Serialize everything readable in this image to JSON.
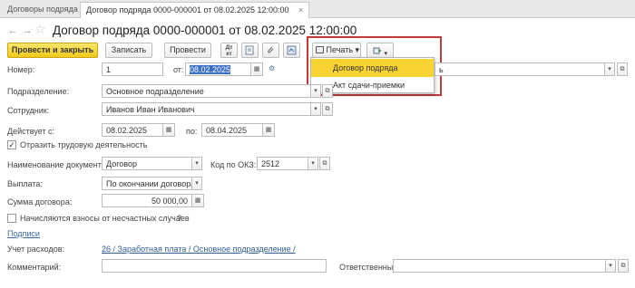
{
  "tabs": [
    {
      "label": "Договоры подряда",
      "active": false
    },
    {
      "label": "Договор подряда 0000-000001 от 08.02.2025 12:00:00",
      "active": true
    }
  ],
  "window": {
    "title": "Договор подряда 0000-000001 от 08.02.2025 12:00:00",
    "close_glyph": "×",
    "star_glyph": "☆",
    "back_glyph": "←",
    "forward_glyph": "→"
  },
  "toolbar": {
    "post_close": "Провести и закрыть",
    "save": "Записать",
    "post": "Провести",
    "dt_kt_top": "Дт",
    "dt_kt_bottom": "кт",
    "print": "Печать",
    "print_arrow": "▾"
  },
  "print_menu": {
    "items": [
      {
        "label": "Договор подряда",
        "selected": true
      },
      {
        "label": "Акт сдачи-приемки",
        "selected": false
      }
    ]
  },
  "form": {
    "number_label": "Номер:",
    "number_value": "1",
    "date_from_label": "от:",
    "date_from_value": "08.02.2025",
    "organization_suffix": "ь",
    "department_label": "Подразделение:",
    "department_value": "Основное подразделение",
    "employee_label": "Сотрудник:",
    "employee_value": "Иванов Иван Иванович",
    "valid_label": "Действует с:",
    "valid_from": "08.02.2025",
    "valid_to_label": "по:",
    "valid_to": "08.04.2025",
    "labor_activity_label": "Отразить трудовую деятельность",
    "labor_activity_checked": true,
    "docname_label": "Наименование документа:",
    "docname_value": "Договор",
    "okz_label": "Код по ОКЗ:",
    "okz_value": "2512",
    "payment_label": "Выплата:",
    "payment_value": "По окончании договора",
    "sum_label": "Сумма договора:",
    "sum_value": "50 000,00",
    "accident_label": "Начисляются взносы от несчастных случаев",
    "accident_help": "?",
    "accident_checked": false,
    "signatures_link": "Подписи",
    "expense_label": "Учет расходов:",
    "expense_value": "26 / Заработная плата / Основное подразделение /",
    "comment_label": "Комментарий:",
    "comment_value": "",
    "responsible_label": "Ответственный:",
    "responsible_value": ""
  },
  "colors": {
    "accent_primary": "#f2c919",
    "menu_selected": "#f9d331",
    "highlight_border": "#c0393b",
    "link": "#3a6ea5"
  }
}
